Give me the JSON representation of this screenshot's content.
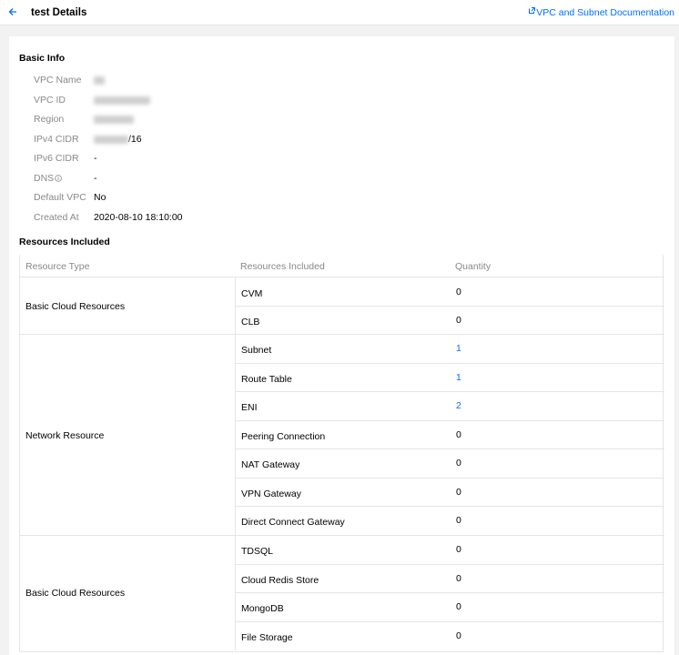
{
  "header": {
    "title": "test Details",
    "doc_link": "VPC and Subnet Documentation"
  },
  "basic_info": {
    "title": "Basic Info",
    "fields": {
      "vpc_name": {
        "label": "VPC Name",
        "value": ""
      },
      "vpc_id": {
        "label": "VPC ID",
        "value": ""
      },
      "region": {
        "label": "Region",
        "value": ""
      },
      "ipv4_cidr": {
        "label": "IPv4 CIDR",
        "value": "/16"
      },
      "ipv6_cidr": {
        "label": "IPv6 CIDR",
        "value": "-"
      },
      "dns": {
        "label": "DNS",
        "value": "-"
      },
      "default_vpc": {
        "label": "Default VPC",
        "value": "No"
      },
      "created_at": {
        "label": "Created At",
        "value": "2020-08-10 18:10:00"
      }
    }
  },
  "resources": {
    "title": "Resources Included",
    "columns": [
      "Resource Type",
      "Resources Included",
      "Quantity"
    ],
    "groups": [
      {
        "type": "Basic Cloud Resources",
        "items": [
          {
            "name": "CVM",
            "qty": "0"
          },
          {
            "name": "CLB",
            "qty": "0"
          }
        ]
      },
      {
        "type": "Network Resource",
        "items": [
          {
            "name": "Subnet",
            "qty": "1"
          },
          {
            "name": "Route Table",
            "qty": "1"
          },
          {
            "name": "ENI",
            "qty": "2"
          },
          {
            "name": "Peering Connection",
            "qty": "0"
          },
          {
            "name": "NAT Gateway",
            "qty": "0"
          },
          {
            "name": "VPN Gateway",
            "qty": "0"
          },
          {
            "name": "Direct Connect Gateway",
            "qty": "0"
          }
        ]
      },
      {
        "type": "Basic Cloud Resources",
        "items": [
          {
            "name": "TDSQL",
            "qty": "0"
          },
          {
            "name": "Cloud Redis Store",
            "qty": "0"
          },
          {
            "name": "MongoDB",
            "qty": "0"
          },
          {
            "name": "File Storage",
            "qty": "0"
          }
        ]
      }
    ]
  },
  "colors": {
    "accent": "#006eff",
    "label": "#888888",
    "border": "#e5e5e5"
  }
}
